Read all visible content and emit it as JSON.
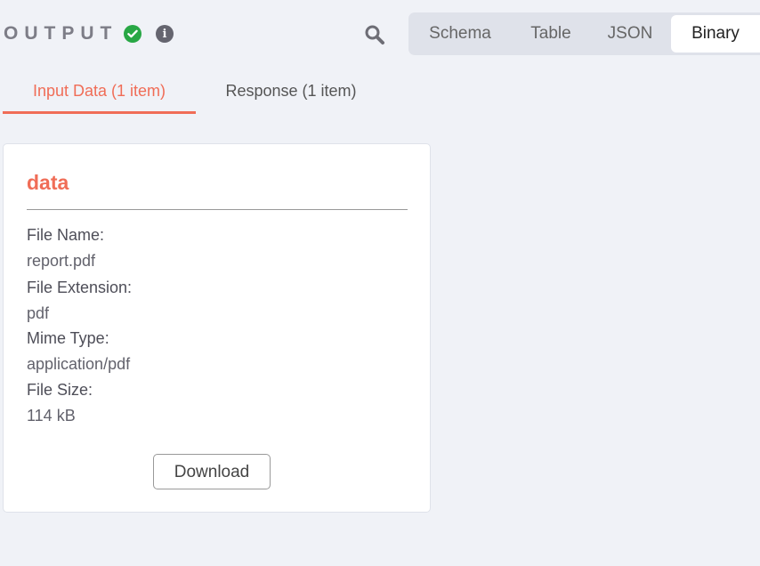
{
  "header": {
    "title": "OUTPUT",
    "status_icon": "success-check-icon",
    "info_icon": "info-icon",
    "search_icon": "search-icon"
  },
  "view_modes": {
    "selected": "Binary",
    "options": [
      "Schema",
      "Table",
      "JSON",
      "Binary"
    ]
  },
  "tabs": [
    {
      "label": "Input Data (1 item)",
      "active": true
    },
    {
      "label": "Response (1 item)",
      "active": false
    }
  ],
  "card": {
    "title": "data",
    "fields": [
      {
        "label": "File Name:",
        "value": "report.pdf"
      },
      {
        "label": "File Extension:",
        "value": "pdf"
      },
      {
        "label": "Mime Type:",
        "value": "application/pdf"
      },
      {
        "label": "File Size:",
        "value": "114 kB"
      }
    ],
    "download_label": "Download"
  },
  "colors": {
    "accent": "#f06d57",
    "success": "#28a745",
    "background": "#f0f2f7"
  }
}
